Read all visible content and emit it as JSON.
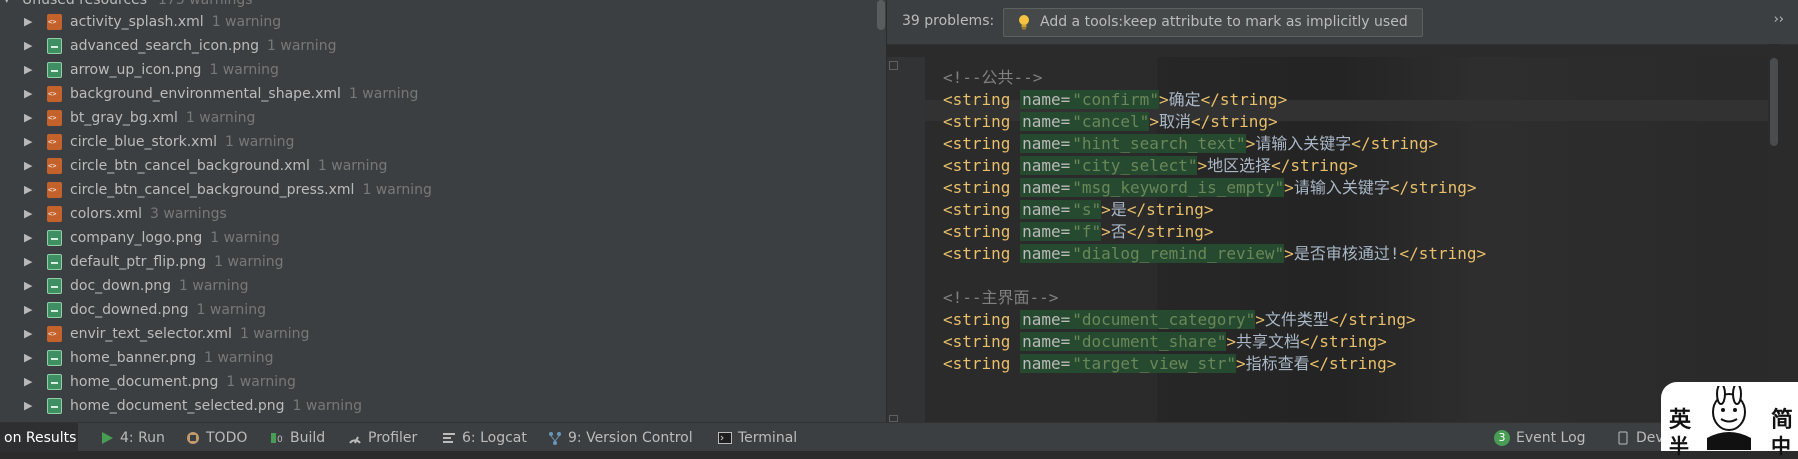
{
  "left_panel": {
    "header": {
      "label": "Unused resources",
      "count": "175 warnings"
    },
    "items": [
      {
        "name": "activity_splash.xml",
        "warn": "1 warning",
        "type": "xml"
      },
      {
        "name": "advanced_search_icon.png",
        "warn": "1 warning",
        "type": "png"
      },
      {
        "name": "arrow_up_icon.png",
        "warn": "1 warning",
        "type": "png"
      },
      {
        "name": "background_environmental_shape.xml",
        "warn": "1 warning",
        "type": "xml"
      },
      {
        "name": "bt_gray_bg.xml",
        "warn": "1 warning",
        "type": "xml"
      },
      {
        "name": "circle_blue_stork.xml",
        "warn": "1 warning",
        "type": "xml"
      },
      {
        "name": "circle_btn_cancel_background.xml",
        "warn": "1 warning",
        "type": "xml"
      },
      {
        "name": "circle_btn_cancel_background_press.xml",
        "warn": "1 warning",
        "type": "xml"
      },
      {
        "name": "colors.xml",
        "warn": "3 warnings",
        "type": "xml"
      },
      {
        "name": "company_logo.png",
        "warn": "1 warning",
        "type": "png"
      },
      {
        "name": "default_ptr_flip.png",
        "warn": "1 warning",
        "type": "png"
      },
      {
        "name": "doc_down.png",
        "warn": "1 warning",
        "type": "png"
      },
      {
        "name": "doc_downed.png",
        "warn": "1 warning",
        "type": "png"
      },
      {
        "name": "envir_text_selector.xml",
        "warn": "1 warning",
        "type": "xml"
      },
      {
        "name": "home_banner.png",
        "warn": "1 warning",
        "type": "png"
      },
      {
        "name": "home_document.png",
        "warn": "1 warning",
        "type": "png"
      },
      {
        "name": "home_document_selected.png",
        "warn": "1 warning",
        "type": "png"
      }
    ]
  },
  "editor": {
    "problems_count": "39 problems:",
    "action": "Add a tools:keep attribute to mark as implicitly used",
    "code": [
      {
        "kind": "comment",
        "text": "<!--公共-->"
      },
      {
        "kind": "string",
        "name": "confirm",
        "value": "确定"
      },
      {
        "kind": "string",
        "name": "cancel",
        "value": "取消"
      },
      {
        "kind": "string",
        "name": "hint_search_text",
        "value": "请输入关键字"
      },
      {
        "kind": "string",
        "name": "city_select",
        "value": "地区选择"
      },
      {
        "kind": "string",
        "name": "msg_keyword_is_empty",
        "value": "请输入关键字"
      },
      {
        "kind": "string",
        "name": "s",
        "value": "是"
      },
      {
        "kind": "string",
        "name": "f",
        "value": "否"
      },
      {
        "kind": "string",
        "name": "dialog_remind_review",
        "value": "是否审核通过!"
      },
      {
        "kind": "blank"
      },
      {
        "kind": "comment",
        "text": "<!--主界面-->"
      },
      {
        "kind": "string",
        "name": "document_category",
        "value": "文件类型"
      },
      {
        "kind": "string",
        "name": "document_share",
        "value": "共享文档"
      },
      {
        "kind": "string",
        "name": "target_view_str",
        "value": "指标查看"
      }
    ]
  },
  "bottom_toolbar": {
    "items": [
      {
        "label": "on Results",
        "selected": true,
        "icon": ""
      },
      {
        "label": "4: Run",
        "icon": "run-icon",
        "mnemonic": "4"
      },
      {
        "label": "TODO",
        "icon": "todo-icon"
      },
      {
        "label": "Build",
        "icon": "build-icon"
      },
      {
        "label": "Profiler",
        "icon": "profiler-icon"
      },
      {
        "label": "6: Logcat",
        "icon": "logcat-icon",
        "mnemonic": "6"
      },
      {
        "label": "9: Version Control",
        "icon": "version-control-icon",
        "mnemonic": "9"
      },
      {
        "label": "Terminal",
        "icon": "terminal-icon"
      },
      {
        "label": "Event Log",
        "icon": "event-log-icon",
        "badge": "3"
      },
      {
        "label": "Dev",
        "icon": "device-icon"
      }
    ]
  },
  "sticker": {
    "chars": [
      "英",
      "简",
      "半",
      "中"
    ]
  },
  "colors": {
    "accent_green": "#6a8759",
    "tag_yellow": "#e8bf6a",
    "warn_gray": "#787878"
  }
}
